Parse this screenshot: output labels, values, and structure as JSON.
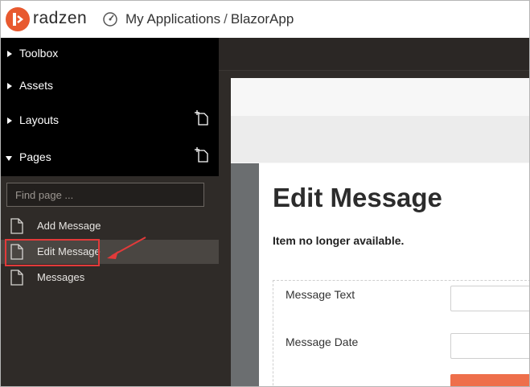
{
  "header": {
    "brand": "radzen",
    "breadcrumb": [
      "My Applications",
      "BlazorApp"
    ],
    "separator": "/",
    "icons": {
      "logo": "radzen-logo-icon",
      "dashboard": "gauge-icon"
    },
    "accent": "#e8592f"
  },
  "sidebar": {
    "sections": [
      {
        "label": "Toolbox",
        "expanded": false
      },
      {
        "label": "Assets",
        "expanded": false
      },
      {
        "label": "Layouts",
        "expanded": false,
        "has_add": true
      },
      {
        "label": "Pages",
        "expanded": true,
        "has_add": true
      }
    ],
    "search": {
      "placeholder": "Find page ..."
    },
    "pages": [
      {
        "label": "Add Message",
        "selected": false
      },
      {
        "label": "Edit Message",
        "selected": true
      },
      {
        "label": "Messages",
        "selected": false
      }
    ],
    "highlight_color": "#e23a3a"
  },
  "canvas": {
    "title": "Edit Message",
    "message": "Item no longer available.",
    "fields": [
      {
        "label": "Message Text",
        "value": ""
      },
      {
        "label": "Message Date",
        "value": ""
      }
    ],
    "button_color": "#ee6f4b"
  }
}
